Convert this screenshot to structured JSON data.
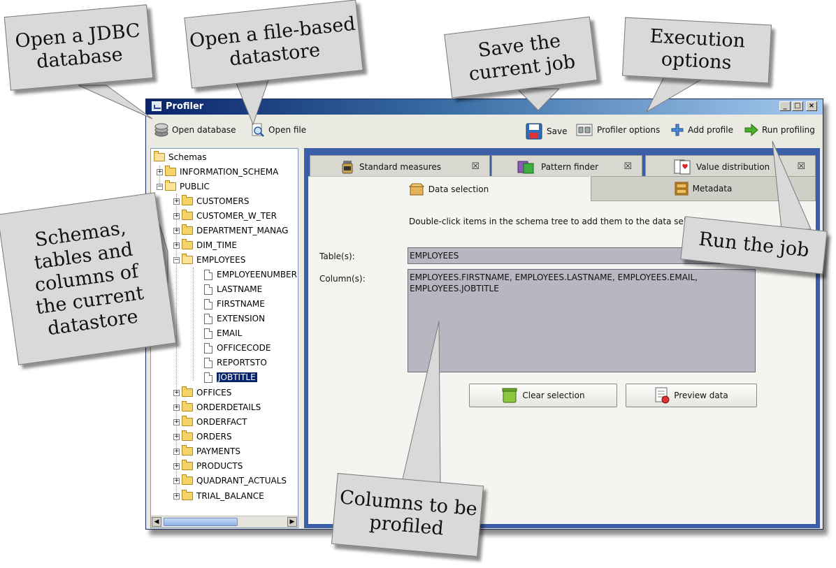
{
  "window": {
    "title": "Profiler",
    "controls": [
      "_",
      "□",
      "×"
    ]
  },
  "toolbar": {
    "open_database": "Open database",
    "open_file": "Open file",
    "save": "Save",
    "profiler_options": "Profiler options",
    "add_profile": "Add profile",
    "run_profiling": "Run profiling"
  },
  "tree": {
    "root": "Schemas",
    "info_schema": "INFORMATION_SCHEMA",
    "public": "PUBLIC",
    "tables_before": [
      "CUSTOMERS",
      "CUSTOMER_W_TER",
      "DEPARTMENT_MANAG",
      "DIM_TIME"
    ],
    "employees": "EMPLOYEES",
    "columns": [
      "EMPLOYEENUMBER",
      "LASTNAME",
      "FIRSTNAME",
      "EXTENSION",
      "EMAIL",
      "OFFICECODE",
      "REPORTSTO"
    ],
    "selected_column": "JOBTITLE",
    "tables_after": [
      "OFFICES",
      "ORDERDETAILS",
      "ORDERFACT",
      "ORDERS",
      "PAYMENTS",
      "PRODUCTS",
      "QUADRANT_ACTUALS",
      "TRIAL_BALANCE"
    ]
  },
  "tabs": {
    "standard_measures": "Standard measures",
    "pattern_finder": "Pattern finder",
    "value_distribution": "Value distribution",
    "close_glyph": "☒",
    "data_selection": "Data selection",
    "metadata": "Metadata"
  },
  "data_selection": {
    "hint": "Double-click items in the schema tree to add them to the data selection.",
    "tables_label": "Table(s):",
    "tables_value": "EMPLOYEES",
    "columns_label": "Column(s):",
    "columns_value": "EMPLOYEES.FIRSTNAME, EMPLOYEES.LASTNAME, EMPLOYEES.EMAIL, EMPLOYEES.JOBTITLE",
    "clear_button": "Clear selection",
    "preview_button": "Preview data"
  },
  "callouts": {
    "open_jdbc": "Open a JDBC database",
    "open_file_datastore": "Open a file-based datastore",
    "save_job": "Save the current job",
    "execution_options": "Execution options",
    "schemas_tables": "Schemas, tables and columns of the current datastore",
    "run_job": "Run the job",
    "columns_profiled": "Columns to be profiled"
  },
  "colors": {
    "title_bar": "#0a246a",
    "panel_background": "#3a5ea8",
    "callout_fill": "#d9d9d9",
    "selection": "#0a246a"
  }
}
